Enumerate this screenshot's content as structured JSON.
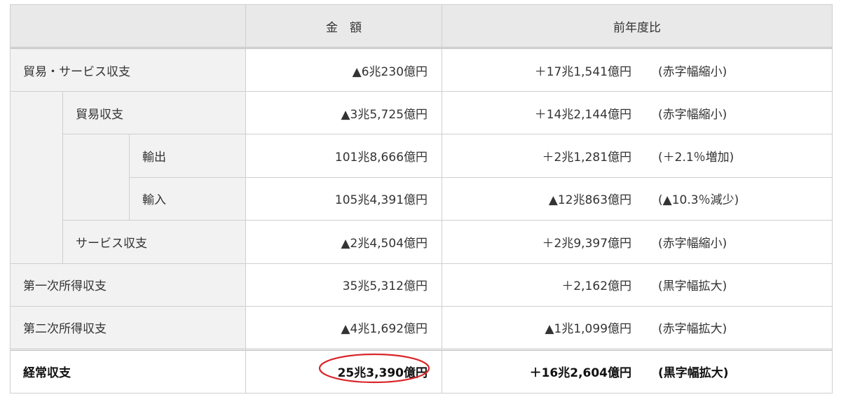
{
  "header": {
    "amount": "金　額",
    "yoy": "前年度比"
  },
  "rows": {
    "trade_services": {
      "label": "貿易・サービス収支",
      "amount": "▲6兆230億円",
      "yoy_value": "＋17兆1,541億円",
      "yoy_note": "(赤字幅縮小)"
    },
    "trade": {
      "label": "貿易収支",
      "amount": "▲3兆5,725億円",
      "yoy_value": "＋14兆2,144億円",
      "yoy_note": "(赤字幅縮小)"
    },
    "exports": {
      "label": "輸出",
      "amount": "101兆8,666億円",
      "yoy_value": "＋2兆1,281億円",
      "yoy_note": "(＋2.1％増加)"
    },
    "imports": {
      "label": "輸入",
      "amount": "105兆4,391億円",
      "yoy_value": "▲12兆863億円",
      "yoy_note": "(▲10.3％減少)"
    },
    "services": {
      "label": "サービス収支",
      "amount": "▲2兆4,504億円",
      "yoy_value": "＋2兆9,397億円",
      "yoy_note": "(赤字幅縮小)"
    },
    "primary_income": {
      "label": "第一次所得収支",
      "amount": "35兆5,312億円",
      "yoy_value": "＋2,162億円",
      "yoy_note": "(黒字幅拡大)"
    },
    "secondary_income": {
      "label": "第二次所得収支",
      "amount": "▲4兆1,692億円",
      "yoy_value": "▲1兆1,099億円",
      "yoy_note": "(赤字幅拡大)"
    },
    "current_account": {
      "label": "経常収支",
      "amount": "25兆3,390億円",
      "yoy_value": "＋16兆2,604億円",
      "yoy_note": "(黒字幅拡大)"
    }
  },
  "highlight": {
    "color": "#d9262b"
  }
}
